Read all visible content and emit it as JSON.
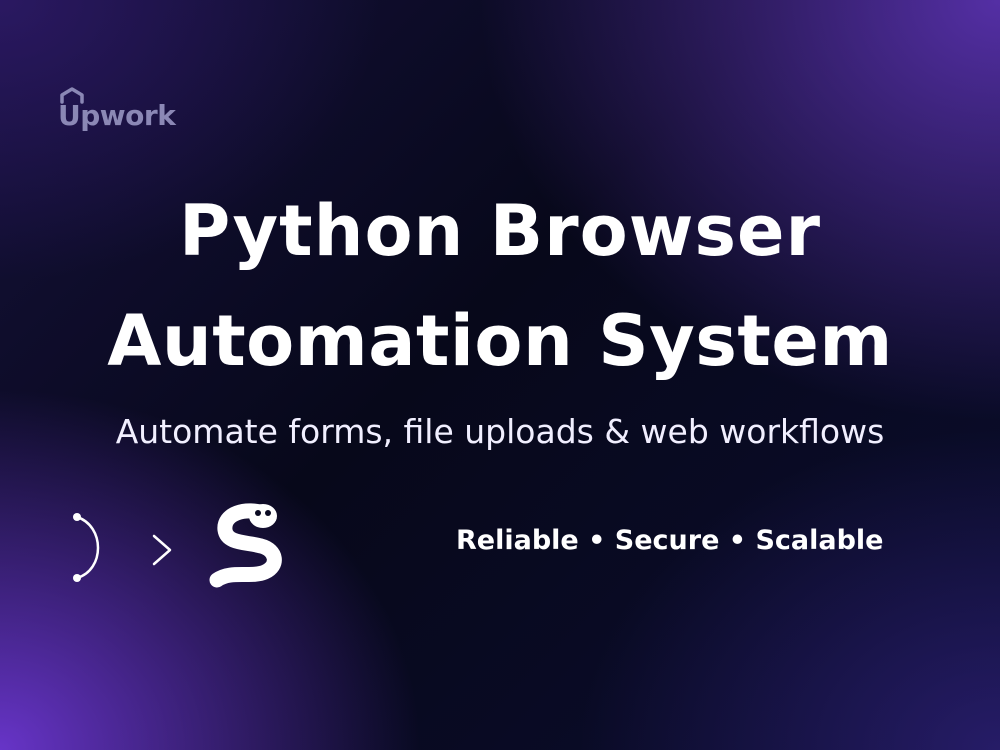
{
  "brand": {
    "logo_text": "Upwork",
    "logo_icon": "upwork-logo-icon",
    "logo_color": "#8b88b5"
  },
  "headline": {
    "line1": "Python Browser",
    "line2": "Automation System"
  },
  "subtitle": "Automate forms, file uploads & web workflows",
  "tagline": "Reliable • Secure • Scalable",
  "icons": {
    "flow": "branch-arrow-icon",
    "python": "python-snake-icon"
  },
  "colors": {
    "accent_purple": "#7c3cf0",
    "background_dark": "#07081a",
    "text": "#ffffff"
  }
}
